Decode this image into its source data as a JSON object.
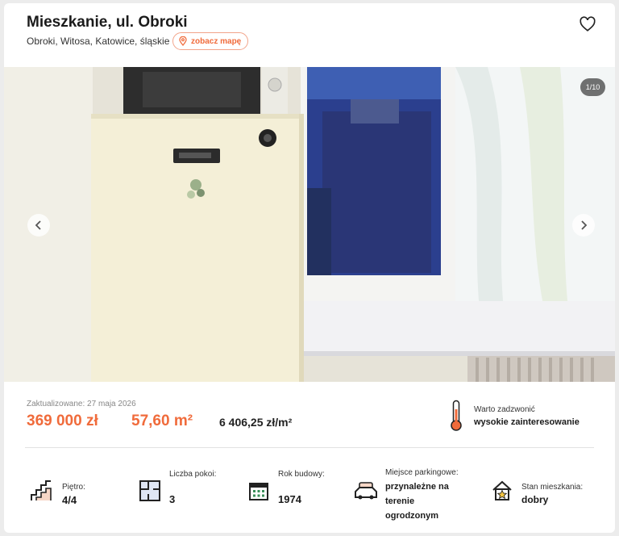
{
  "listing": {
    "title": "Mieszkanie, ul. Obroki",
    "address": "Obroki, Witosa, Katowice, śląskie",
    "map_button": "zobacz mapę"
  },
  "gallery": {
    "counter": "1/10",
    "prev_icon": "chevron-left-icon",
    "next_icon": "chevron-right-icon"
  },
  "summary": {
    "updated": "Zaktualizowane: 27 maja 2026",
    "price": "369 000 zł",
    "area": "57,60 m²",
    "price_per_m2": "6 406,25 zł/m²",
    "hint_label": "Warto zadzwonić",
    "hint_value": "wysokie zainteresowanie"
  },
  "features": [
    {
      "label": "Piętro:",
      "value": "4/4",
      "icon": "stairs-icon"
    },
    {
      "label": "Liczba pokoi:",
      "value": "3",
      "icon": "floor-plan-icon"
    },
    {
      "label": "Rok budowy:",
      "value": "1974",
      "icon": "calendar-icon"
    },
    {
      "label": "Miejsce parkingowe:",
      "value": "przynależne na terenie ogrodzonym",
      "icon": "parking-car-icon"
    },
    {
      "label": "Stan mieszkania:",
      "value": "dobry",
      "icon": "house-star-icon"
    }
  ],
  "colors": {
    "accent": "#f06b3b",
    "text": "#1b1b1b"
  }
}
